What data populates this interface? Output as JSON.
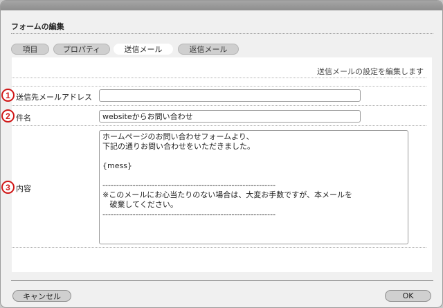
{
  "dialog": {
    "title": "フォームの編集"
  },
  "tabs": [
    {
      "label": "項目",
      "active": false
    },
    {
      "label": "プロパティ",
      "active": false
    },
    {
      "label": "送信メール",
      "active": true
    },
    {
      "label": "返信メール",
      "active": false
    }
  ],
  "panel": {
    "description": "送信メールの設定を編集します",
    "fields": {
      "to": {
        "marker": "1",
        "label": "送信先メールアドレス",
        "value": ""
      },
      "subject": {
        "marker": "2",
        "label": "件名",
        "value": "websiteからお問い合わせ"
      },
      "body": {
        "marker": "3",
        "label": "内容",
        "value": "ホームページのお問い合わせフォームより、\n下記の通りお問い合わせをいただきました。\n\n{mess}\n\n---------------------------------------------------------------\n※このメールにお心当たりのない場合は、大変お手数ですが、本メールを\n   破棄してください。\n---------------------------------------------------------------"
      }
    }
  },
  "footer": {
    "cancel_label": "キャンセル",
    "ok_label": "OK"
  },
  "colors": {
    "marker": "#d01818",
    "active_tab": "#ffffff",
    "tab": "#cfcfcf",
    "button": "#d0d0d0"
  }
}
